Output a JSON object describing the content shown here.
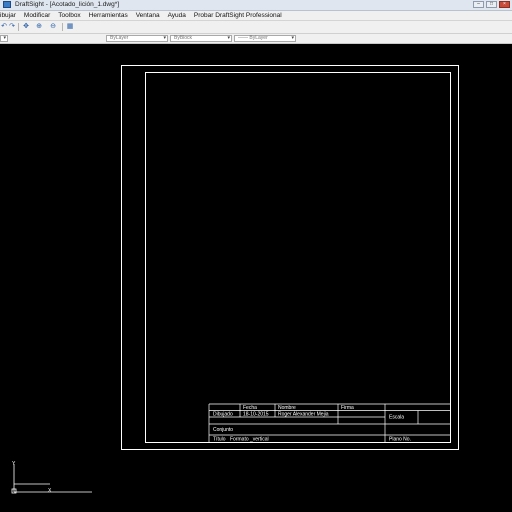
{
  "window": {
    "title": "DraftSight - [Acotado_lición_1.dwg*]"
  },
  "menu": {
    "items": [
      "ibujar",
      "Modificar",
      "Toolbox",
      "Herramientas",
      "Ventana",
      "Ayuda",
      "Probar DraftSight Professional"
    ]
  },
  "properties_toolbar": {
    "color": "ByLayer",
    "linestyle": "ByBlock",
    "lineweight": "—— ByLayer"
  },
  "title_block": {
    "header_fecha": "Fecha",
    "header_nombre": "Nombre",
    "header_firma": "Firma",
    "dibujado_label": "Dibujado",
    "dibujado_fecha": "18-10-2015",
    "dibujado_nombre": "Roger Alexander Mejia",
    "escala_label": "Escala",
    "conjunto_label": "Conjunto",
    "titulo_label": "Título",
    "titulo_value": "Formato _vertical",
    "plano_label": "Plano No."
  },
  "ucs": {
    "x_label": "X",
    "y_label": "Y"
  }
}
